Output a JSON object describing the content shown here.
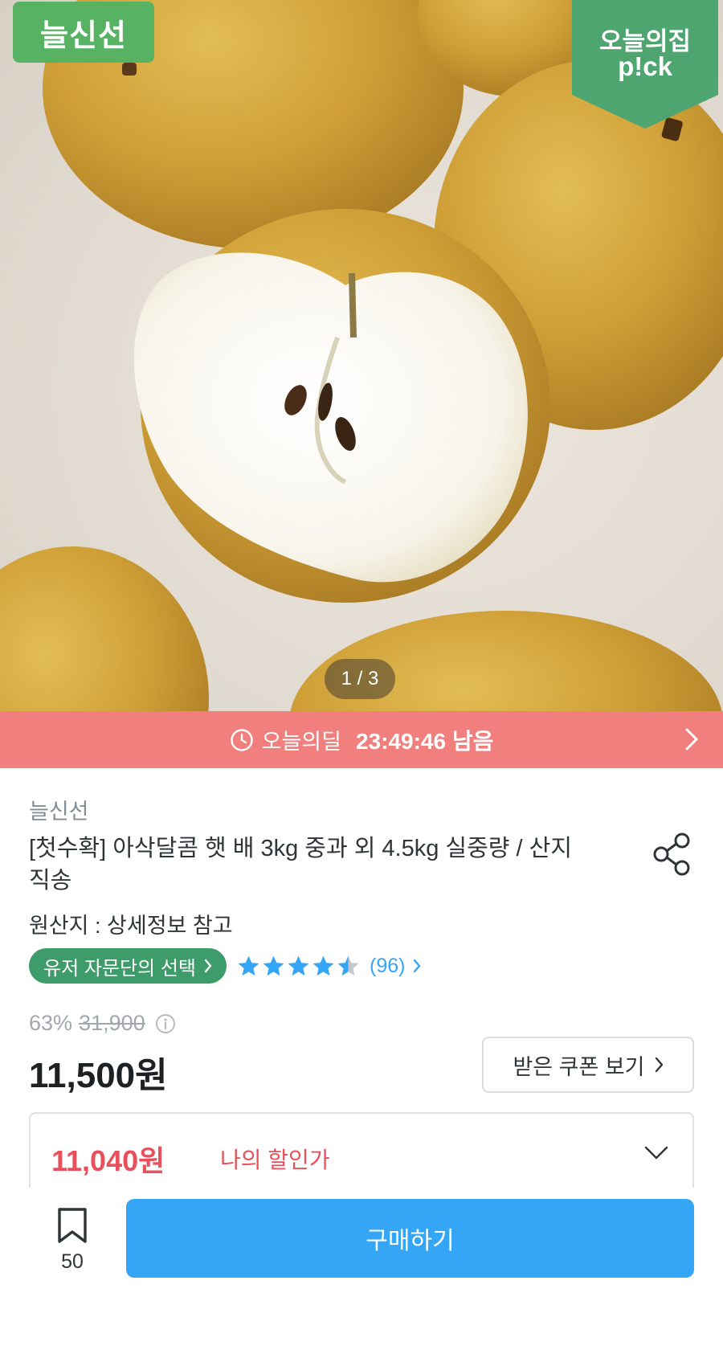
{
  "hero": {
    "brand_badge": "늘신선",
    "pick_badge_line1": "오늘의집",
    "pick_badge_line2": "p!ck",
    "pager": "1 / 3"
  },
  "deal_bar": {
    "icon": "clock-icon",
    "label": "오늘의딜",
    "remaining": "23:49:46 남음"
  },
  "product": {
    "brand": "늘신선",
    "title": "[첫수확] 아삭달콤 햇 배 3kg 중과 외 4.5kg 실중량 / 산지직송",
    "origin": "원산지 : 상세정보 참고",
    "advisor_badge": "유저 자문단의 선택",
    "rating": 4.5,
    "review_count": "(96)",
    "discount_rate": "63%",
    "original_price": "31,900",
    "price": "11,500원",
    "coupon_button": "받은 쿠폰 보기"
  },
  "my_discount": {
    "amount": "11,040원",
    "label": "나의 할인가"
  },
  "bottom_bar": {
    "bookmark_count": "50",
    "buy_button": "구매하기"
  },
  "colors": {
    "deal_bar": "#f07f7d",
    "brand_badge": "#58b263",
    "advisor_badge": "#3e9b6a",
    "star": "#35a5f5",
    "buy_button": "#35a5f5",
    "discount_text": "#e8505b"
  }
}
